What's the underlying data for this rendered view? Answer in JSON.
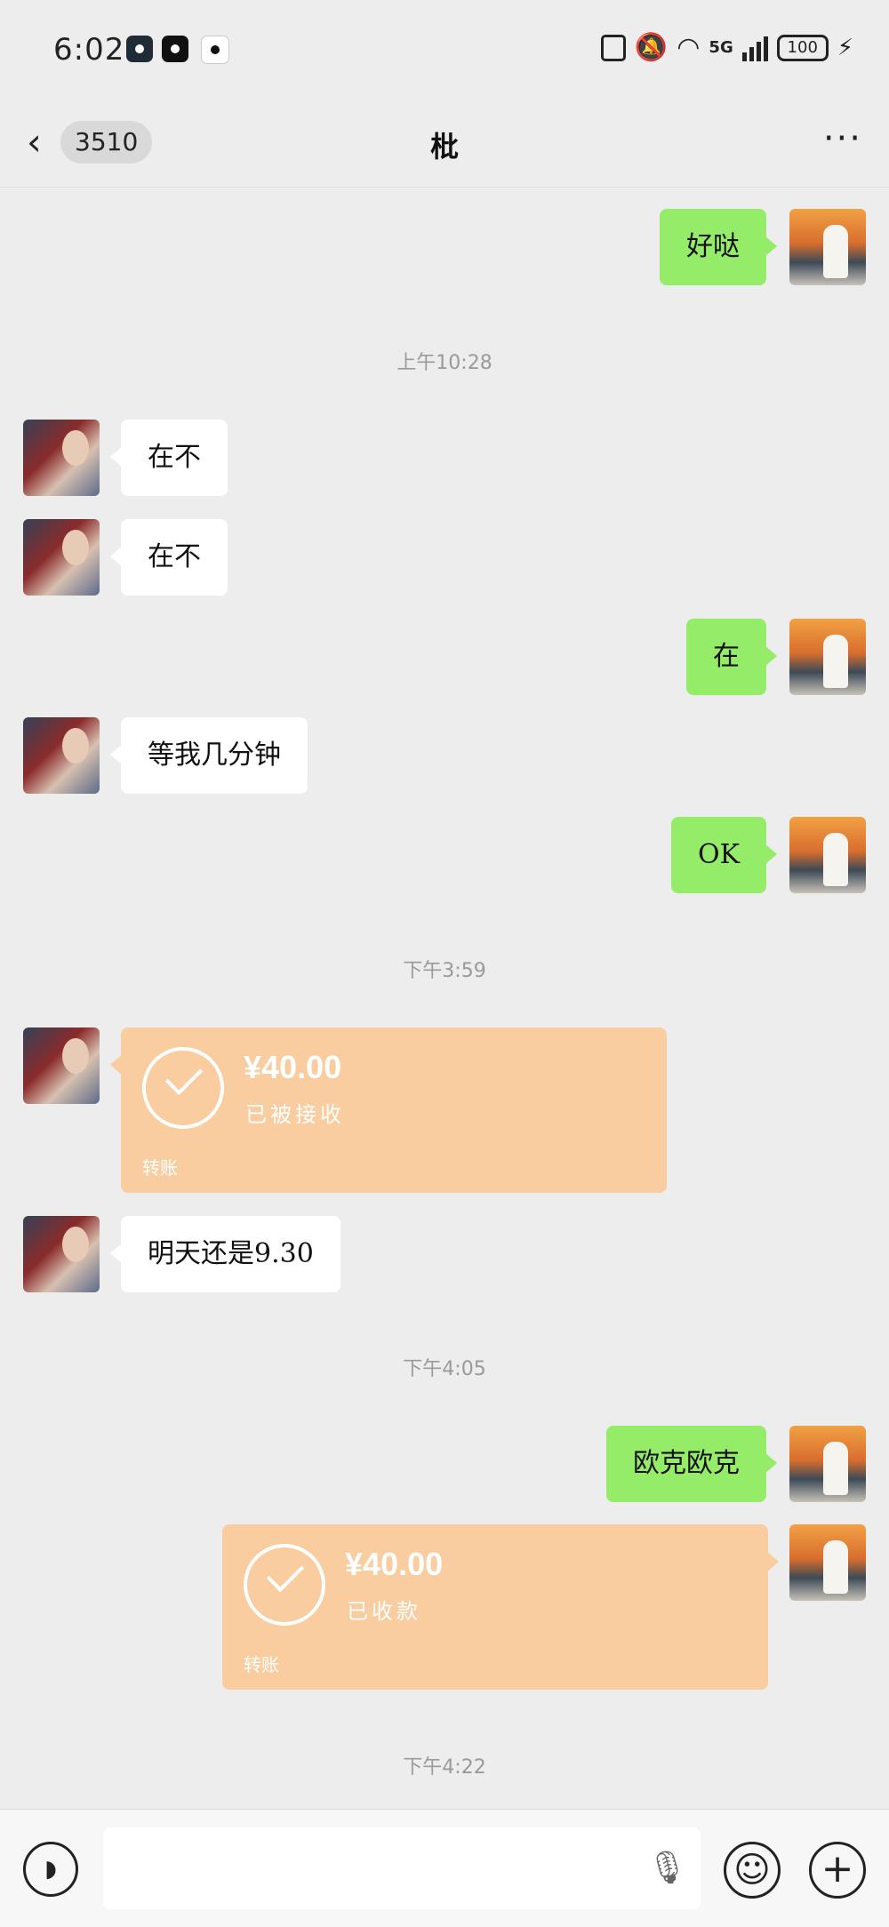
{
  "status_bar": {
    "time": "6:02",
    "network": "5G",
    "battery": "100"
  },
  "nav": {
    "unread_count": "3510",
    "title": "枇",
    "more": "···"
  },
  "messages": [
    {
      "sender": "me",
      "text": "好哒"
    },
    {
      "timestamp": "上午10:28"
    },
    {
      "sender": "her",
      "text": "在不"
    },
    {
      "sender": "her",
      "text": "在不"
    },
    {
      "sender": "me",
      "text": "在"
    },
    {
      "sender": "her",
      "text": "等我几分钟"
    },
    {
      "sender": "me",
      "text": "OK"
    },
    {
      "timestamp": "下午3:59"
    },
    {
      "sender": "her",
      "transfer": {
        "amount": "¥40.00",
        "status": "已被接收",
        "label": "转账"
      }
    },
    {
      "sender": "her",
      "text": "明天还是9.30"
    },
    {
      "timestamp": "下午4:05"
    },
    {
      "sender": "me",
      "text": "欧克欧克"
    },
    {
      "sender": "me",
      "transfer": {
        "amount": "¥40.00",
        "status": "已收款",
        "label": "转账"
      }
    },
    {
      "timestamp": "下午4:22"
    }
  ],
  "composer": {
    "placeholder": ""
  },
  "colors": {
    "my_bubble": "#95ec69",
    "their_bubble": "#ffffff",
    "transfer": "#f9cd9f",
    "background": "#ededed"
  }
}
